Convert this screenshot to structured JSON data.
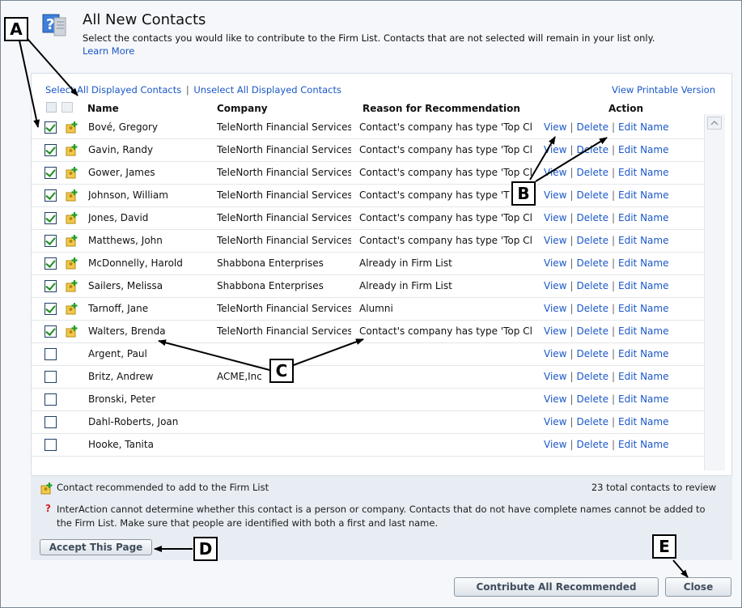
{
  "header": {
    "title": "All New Contacts",
    "instructions": "Select the contacts you would like to contribute to the Firm List. Contacts that are not selected will remain in your list only.",
    "learn_more": "Learn More"
  },
  "links": {
    "select_all": "Select All Displayed Contacts",
    "separator": "|",
    "unselect_all": "Unselect All Displayed Contacts",
    "printable": "View Printable Version"
  },
  "columns": {
    "name": "Name",
    "company": "Company",
    "reason": "Reason for Recommendation",
    "action": "Action"
  },
  "actions": {
    "view": "View",
    "delete": "Delete",
    "edit": "Edit Name",
    "sep": "|"
  },
  "rows": [
    {
      "checked": true,
      "recommended": true,
      "name": "Bové, Gregory",
      "company": "TeleNorth Financial Services",
      "reason": "Contact's company has type 'Top Cl"
    },
    {
      "checked": true,
      "recommended": true,
      "name": "Gavin, Randy",
      "company": "TeleNorth Financial Services",
      "reason": "Contact's company has type 'Top Cl"
    },
    {
      "checked": true,
      "recommended": true,
      "name": "Gower, James",
      "company": "TeleNorth Financial Services",
      "reason": "Contact's company has type 'Top Cl"
    },
    {
      "checked": true,
      "recommended": true,
      "name": "Johnson, William",
      "company": "TeleNorth Financial Services",
      "reason": "Contact's company has type 'T"
    },
    {
      "checked": true,
      "recommended": true,
      "name": "Jones, David",
      "company": "TeleNorth Financial Services",
      "reason": "Contact's company has type 'Top Cl"
    },
    {
      "checked": true,
      "recommended": true,
      "name": "Matthews, John",
      "company": "TeleNorth Financial Services",
      "reason": "Contact's company has type 'Top Cl"
    },
    {
      "checked": true,
      "recommended": true,
      "name": "McDonnelly, Harold",
      "company": "Shabbona Enterprises",
      "reason": "Already in Firm List"
    },
    {
      "checked": true,
      "recommended": true,
      "name": "Sailers, Melissa",
      "company": "Shabbona Enterprises",
      "reason": "Already in Firm List"
    },
    {
      "checked": true,
      "recommended": true,
      "name": "Tarnoff, Jane",
      "company": "TeleNorth Financial Services",
      "reason": "Alumni"
    },
    {
      "checked": true,
      "recommended": true,
      "name": "Walters, Brenda",
      "company": "TeleNorth Financial Services",
      "reason": "Contact's company has type 'Top Cl"
    },
    {
      "checked": false,
      "recommended": false,
      "name": "Argent, Paul",
      "company": "",
      "reason": ""
    },
    {
      "checked": false,
      "recommended": false,
      "name": "Britz, Andrew",
      "company": "ACME,Inc",
      "reason": ""
    },
    {
      "checked": false,
      "recommended": false,
      "name": "Bronski, Peter",
      "company": "",
      "reason": ""
    },
    {
      "checked": false,
      "recommended": false,
      "name": "Dahl-Roberts, Joan",
      "company": "",
      "reason": ""
    },
    {
      "checked": false,
      "recommended": false,
      "name": "Hooke, Tanita",
      "company": "",
      "reason": ""
    }
  ],
  "footer": {
    "legend": "Contact recommended to add to the Firm List",
    "total": "23 total contacts to review",
    "warn_mark": "?",
    "warning": "InterAction cannot determine whether this contact is a person or company. Contacts that do not have complete names cannot be added to the Firm List. Make sure that people are identified with both a first and last name."
  },
  "buttons": {
    "accept": "Accept This Page",
    "contribute": "Contribute All Recommended",
    "close": "Close"
  },
  "callouts": {
    "a": "A",
    "b": "B",
    "c": "C",
    "d": "D",
    "e": "E"
  },
  "colors": {
    "link": "#1b57c7",
    "check": "#1c8f1c",
    "footer_bg": "#e8edf3"
  }
}
